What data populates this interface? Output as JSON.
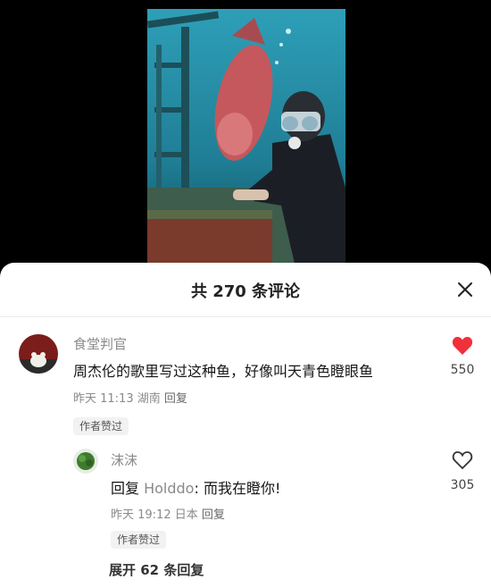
{
  "sheet": {
    "title": "共 270 条评论"
  },
  "comment": {
    "username": "食堂判官",
    "text": "周杰伦的歌里写过这种鱼，好像叫天青色瞪眼鱼",
    "time": "昨天 11:13",
    "location": "湖南",
    "reply_label": "回复",
    "badge": "作者赞过",
    "like_count": "550",
    "liked": true
  },
  "reply": {
    "username": "沫沫",
    "prefix": "回复 ",
    "mention": "Holddo",
    "text": ": 而我在瞪你!",
    "time": "昨天 19:12",
    "location": "日本",
    "reply_label": "回复",
    "badge": "作者赞过",
    "like_count": "305",
    "liked": false
  },
  "expand": {
    "label": "展开 62 条回复"
  },
  "colors": {
    "like_active": "#f0303b",
    "sheet_bg": "#ffffff"
  }
}
